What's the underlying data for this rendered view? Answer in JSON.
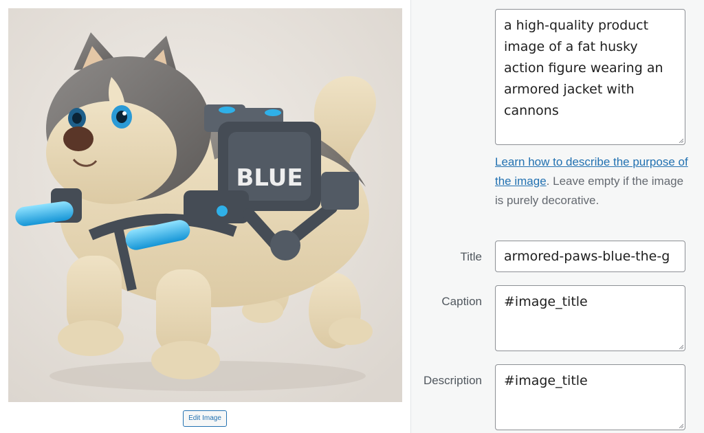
{
  "image": {
    "alt": "Husky action figure wearing an armored jacket with cannons",
    "jacket_text": "BLUE"
  },
  "edit_button": {
    "label": "Edit Image"
  },
  "attachment_details": {
    "alt_text": {
      "value": "a high-quality product image of a fat husky action figure wearing an armored jacket with cannons"
    },
    "alt_help": {
      "link_text": "Learn how to describe the purpose of the image",
      "suffix": ". Leave empty if the image is purely decorative."
    },
    "title": {
      "label": "Title",
      "value": "armored-paws-blue-the-g"
    },
    "caption": {
      "label": "Caption",
      "value": "#image_title"
    },
    "description": {
      "label": "Description",
      "value": "#image_title"
    }
  },
  "colors": {
    "link": "#2271b1",
    "sidebar_bg": "#f6f7f7",
    "field_border": "#8c8f94",
    "cannon": "#2fb0e8",
    "armor": "#454c55"
  }
}
